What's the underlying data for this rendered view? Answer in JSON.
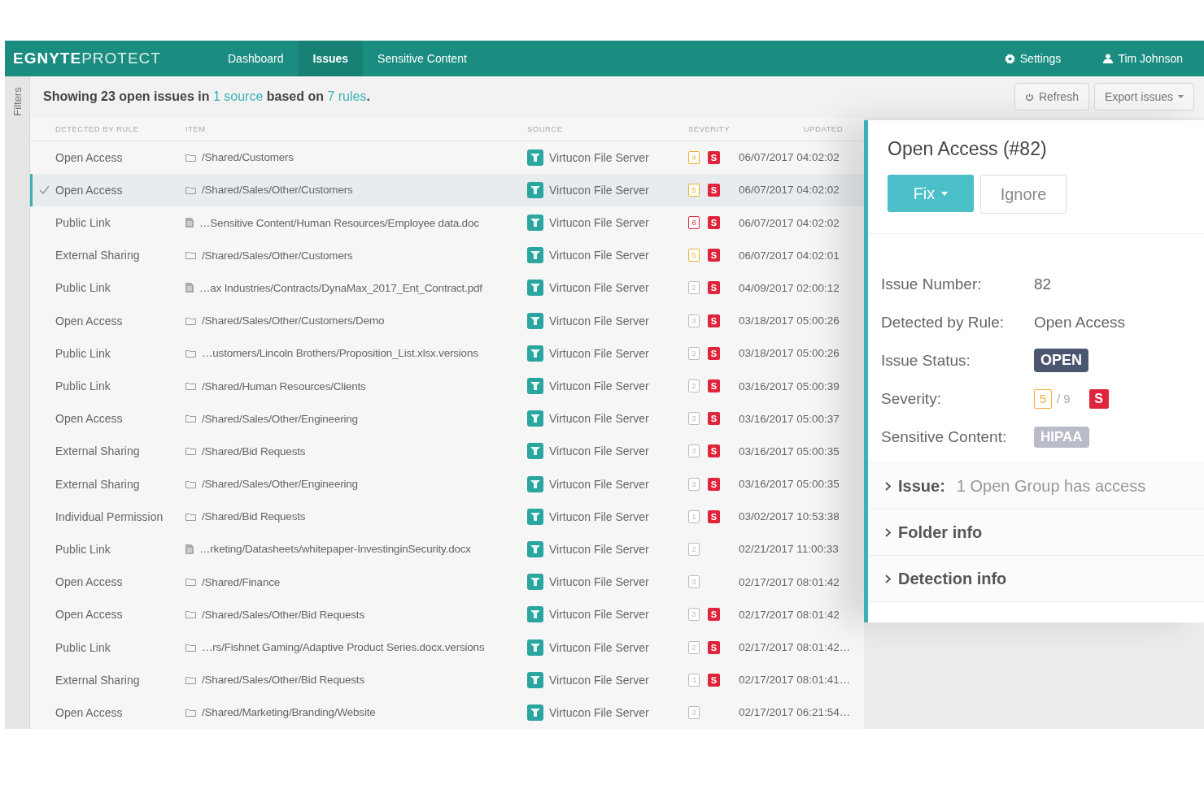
{
  "nav": {
    "logo_brand": "EGNYTE",
    "logo_product": "PROTECT",
    "tabs": [
      {
        "label": "Dashboard",
        "selected": false
      },
      {
        "label": "Issues",
        "selected": true
      },
      {
        "label": "Sensitive Content",
        "selected": false
      }
    ],
    "settings": "Settings",
    "user": "Tim Johnson"
  },
  "filters_label": "Filters",
  "summary_parts": [
    {
      "kind": "text",
      "text": "Showing 23 open issues in "
    },
    {
      "kind": "link",
      "text": "1 source"
    },
    {
      "kind": "text",
      "text": " based on "
    },
    {
      "kind": "link",
      "text": "7 rules"
    },
    {
      "kind": "text",
      "text": "."
    }
  ],
  "toolbar": {
    "refresh": "Refresh",
    "export": "Export issues"
  },
  "table": {
    "columns": [
      "DETECTED BY RULE",
      "ITEM",
      "SOURCE",
      "SEVERITY",
      "UPDATED"
    ],
    "rows": [
      {
        "rule": "Open Access",
        "kind": "folder",
        "item": "/Shared/Customers",
        "source": "Virtucon File Server",
        "severity": "4",
        "color": "#f0b030",
        "sensitive": "S",
        "updated": "06/07/2017 04:02:02",
        "selected": false
      },
      {
        "rule": "Open Access",
        "kind": "folder",
        "item": "/Shared/Sales/Other/Customers",
        "source": "Virtucon File Server",
        "severity": "5",
        "color": "#f0b030",
        "sensitive": "S",
        "updated": "06/07/2017 04:02:02",
        "selected": true
      },
      {
        "rule": "Public Link",
        "kind": "file",
        "item": "…Sensitive Content/Human Resources/Employee data.doc",
        "source": "Virtucon File Server",
        "severity": "8",
        "color": "#e0243c",
        "sensitive": "S",
        "updated": "06/07/2017 04:02:02",
        "selected": false
      },
      {
        "rule": "External Sharing",
        "kind": "folder",
        "item": "/Shared/Sales/Other/Customers",
        "source": "Virtucon File Server",
        "severity": "5",
        "color": "#f0b030",
        "sensitive": "S",
        "updated": "06/07/2017 04:02:01",
        "selected": false
      },
      {
        "rule": "Public Link",
        "kind": "file",
        "item": "…ax Industries/Contracts/DynaMax_2017_Ent_Contract.pdf",
        "source": "Virtucon File Server",
        "severity": "2",
        "color": "#bbbbbb",
        "sensitive": "S",
        "updated": "04/09/2017 02:00:12",
        "selected": false
      },
      {
        "rule": "Open Access",
        "kind": "folder",
        "item": "/Shared/Sales/Other/Customers/Demo",
        "source": "Virtucon File Server",
        "severity": "3",
        "color": "#bbbbbb",
        "sensitive": "S",
        "updated": "03/18/2017 05:00:26",
        "selected": false
      },
      {
        "rule": "Public Link",
        "kind": "folder",
        "item": "…ustomers/Lincoln Brothers/Proposition_List.xlsx.versions",
        "source": "Virtucon File Server",
        "severity": "2",
        "color": "#bbbbbb",
        "sensitive": "S",
        "updated": "03/18/2017 05:00:26",
        "selected": false
      },
      {
        "rule": "Public Link",
        "kind": "folder",
        "item": "/Shared/Human Resources/Clients",
        "source": "Virtucon File Server",
        "severity": "2",
        "color": "#bbbbbb",
        "sensitive": "S",
        "updated": "03/16/2017 05:00:39",
        "selected": false
      },
      {
        "rule": "Open Access",
        "kind": "folder",
        "item": "/Shared/Sales/Other/Engineering",
        "source": "Virtucon File Server",
        "severity": "3",
        "color": "#bbbbbb",
        "sensitive": "S",
        "updated": "03/16/2017 05:00:37",
        "selected": false
      },
      {
        "rule": "External Sharing",
        "kind": "folder",
        "item": "/Shared/Bid Requests",
        "source": "Virtucon File Server",
        "severity": "3",
        "color": "#bbbbbb",
        "sensitive": "S",
        "updated": "03/16/2017 05:00:35",
        "selected": false
      },
      {
        "rule": "External Sharing",
        "kind": "folder",
        "item": "/Shared/Sales/Other/Engineering",
        "source": "Virtucon File Server",
        "severity": "3",
        "color": "#bbbbbb",
        "sensitive": "S",
        "updated": "03/16/2017 05:00:35",
        "selected": false
      },
      {
        "rule": "Individual Permission",
        "kind": "folder",
        "item": "/Shared/Bid Requests",
        "source": "Virtucon File Server",
        "severity": "1",
        "color": "#bbbbbb",
        "sensitive": "S",
        "updated": "03/02/2017 10:53:38",
        "selected": false
      },
      {
        "rule": "Public Link",
        "kind": "file",
        "item": "…rketing/Datasheets/whitepaper-InvestinginSecurity.docx",
        "source": "Virtucon File Server",
        "severity": "2",
        "color": "#bbbbbb",
        "updated": "02/21/2017 11:00:33",
        "selected": false
      },
      {
        "rule": "Open Access",
        "kind": "folder",
        "item": "/Shared/Finance",
        "source": "Virtucon File Server",
        "severity": "3",
        "color": "#bbbbbb",
        "updated": "02/17/2017 08:01:42",
        "selected": false
      },
      {
        "rule": "Open Access",
        "kind": "folder",
        "item": "/Shared/Sales/Other/Bid Requests",
        "source": "Virtucon File Server",
        "severity": "3",
        "color": "#bbbbbb",
        "sensitive": "S",
        "updated": "02/17/2017 08:01:42",
        "selected": false
      },
      {
        "rule": "Public Link",
        "kind": "folder",
        "item": "…rs/Fishnet Gaming/Adaptive Product Series.docx.versions",
        "source": "Virtucon File Server",
        "severity": "2",
        "color": "#bbbbbb",
        "sensitive": "S",
        "updated": "02/17/2017 08:01:42…",
        "selected": false
      },
      {
        "rule": "External Sharing",
        "kind": "folder",
        "item": "/Shared/Sales/Other/Bid Requests",
        "source": "Virtucon File Server",
        "severity": "3",
        "color": "#bbbbbb",
        "sensitive": "S",
        "updated": "02/17/2017 08:01:41…",
        "selected": false
      },
      {
        "rule": "Open Access",
        "kind": "folder",
        "item": "/Shared/Marketing/Branding/Website",
        "source": "Virtucon File Server",
        "severity": "3",
        "color": "#bbbbbb",
        "updated": "02/17/2017 06:21:54…",
        "selected": false
      }
    ]
  },
  "panel": {
    "title": "Open Access (#82)",
    "fix": "Fix",
    "ignore": "Ignore",
    "fields": [
      {
        "kind": "text",
        "label": "Issue Number:",
        "value": "82"
      },
      {
        "kind": "text",
        "label": "Detected by Rule:",
        "value": "Open Access"
      },
      {
        "kind": "status",
        "label": "Issue Status:",
        "value": "OPEN"
      },
      {
        "kind": "severity",
        "label": "Severity:",
        "value": "5",
        "color": "#f0b030",
        "max": "/ 9",
        "sensitive": "S"
      },
      {
        "kind": "tag",
        "label": "Sensitive Content:",
        "value": "HIPAA"
      }
    ],
    "sections": [
      {
        "label": "Issue:",
        "value": "1 Open Group has access",
        "expanded": false
      },
      {
        "label": "Folder info",
        "expanded": false
      },
      {
        "label": "Detection info",
        "expanded": false
      }
    ]
  }
}
